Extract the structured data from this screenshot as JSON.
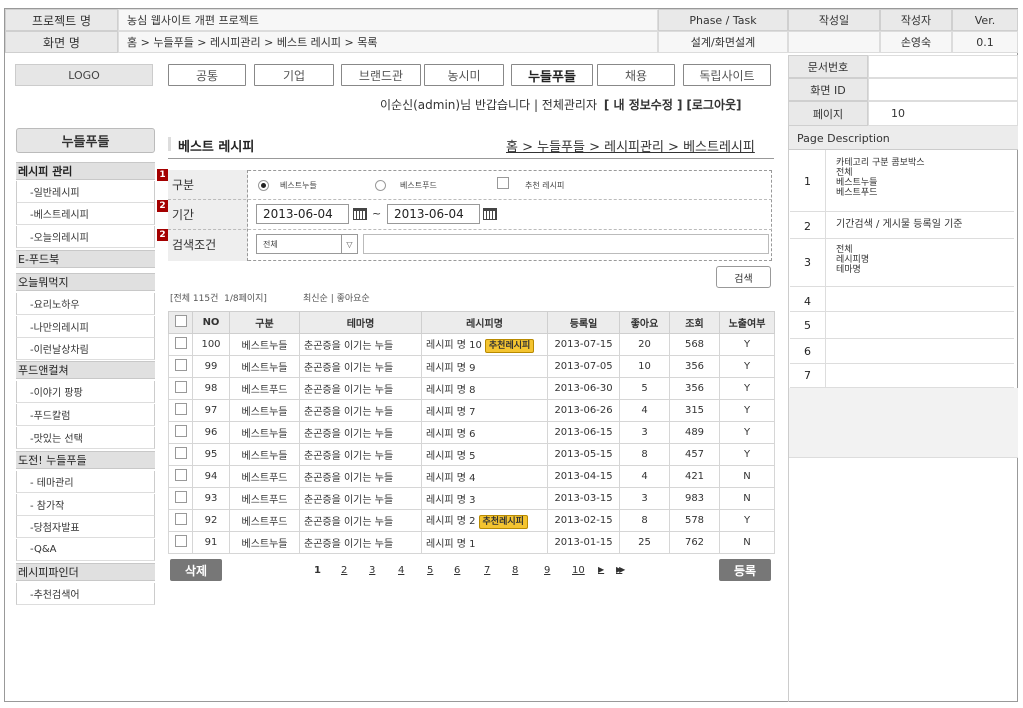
{
  "header": {
    "project_label": "프로젝트 명",
    "project_value": "농심 웹사이트 개편 프로젝트",
    "phase_label": "Phase / Task",
    "date_label": "작성일",
    "author_label": "작성자",
    "ver_label": "Ver.",
    "screen_label": "화면 명",
    "screen_value": "홈 > 누들푸들 > 레시피관리 > 베스트 레시피 > 목록",
    "phase_value": "설계/화면설계",
    "author_value": "손영숙",
    "ver_value": "0.1"
  },
  "meta": {
    "doc_no_label": "문서번호",
    "screen_id_label": "화면 ID",
    "page_label": "페이지",
    "page_value": "10"
  },
  "logo": "LOGO",
  "tabs": [
    "공통",
    "기업",
    "브랜드관",
    "농시미",
    "누들푸들",
    "채용",
    "독립사이트"
  ],
  "user_bar": {
    "greeting": "이순신(admin)님 반갑습니다 | 전체관리자",
    "edit_info": "[ 내 정보수정 ]",
    "logout": "[로그아웃]"
  },
  "sidebar": {
    "title": "누들푸들",
    "groups": [
      {
        "label": "레시피 관리",
        "items": [
          "-일반레시피",
          "-베스트레시피",
          "-오늘의레시피"
        ]
      },
      {
        "label": "E-푸드북",
        "items": []
      },
      {
        "label": "오늘뭐먹지",
        "items": [
          "-요리노하우",
          "-나만의레시피",
          "-이런날상차림"
        ]
      },
      {
        "label": "푸드앤컬쳐",
        "items": [
          "-이야기 팡팡",
          "-푸드칼럼",
          "-맛있는 선택"
        ]
      },
      {
        "label": "도전! 누들푸들",
        "items": [
          "- 테마관리",
          "- 참가작",
          "-당첨자발표",
          "-Q&A"
        ]
      },
      {
        "label": "레시피파인더",
        "items": [
          "-추천검색어"
        ]
      }
    ]
  },
  "content": {
    "section_title": "베스트 레시피",
    "breadcrumb": "홈 > 누들푸들 > 레시피관리 > 베스트레시피"
  },
  "filters": {
    "markers": [
      "1",
      "2",
      "2"
    ],
    "category_label": "구분",
    "radio_best_noodle": "베스트누들",
    "radio_best_food": "베스트푸드",
    "check_recommended": "추천 레시피",
    "period_label": "기간",
    "date_from": "2013-06-04",
    "date_sep": "~",
    "date_to": "2013-06-04",
    "search_cond_label": "검색조건",
    "search_select": "전체",
    "search_button": "검색"
  },
  "list_info": {
    "summary": "[전체 115건  1/8페이지]",
    "sort": "최신순 | 좋아요순"
  },
  "table": {
    "columns": [
      "NO",
      "구분",
      "테마명",
      "레시피명",
      "등록일",
      "좋아요",
      "조회",
      "노출여부"
    ],
    "badge_label": "추천레시피",
    "rows": [
      {
        "no": "100",
        "type": "베스트누들",
        "theme": "춘곤증을 이기는 누들",
        "recipe": "레시피 명 10",
        "badge": true,
        "date": "2013-07-15",
        "likes": "20",
        "views": "568",
        "show": "Y"
      },
      {
        "no": "99",
        "type": "베스트누들",
        "theme": "춘곤증을 이기는 누들",
        "recipe": "레시피 명 9",
        "badge": false,
        "date": "2013-07-05",
        "likes": "10",
        "views": "356",
        "show": "Y"
      },
      {
        "no": "98",
        "type": "베스트푸드",
        "theme": "춘곤증을 이기는 누들",
        "recipe": "레시피 명 8",
        "badge": false,
        "date": "2013-06-30",
        "likes": "5",
        "views": "356",
        "show": "Y"
      },
      {
        "no": "97",
        "type": "베스트누들",
        "theme": "춘곤증을 이기는 누들",
        "recipe": "레시피 명 7",
        "badge": false,
        "date": "2013-06-26",
        "likes": "4",
        "views": "315",
        "show": "Y"
      },
      {
        "no": "96",
        "type": "베스트누들",
        "theme": "춘곤증을 이기는 누들",
        "recipe": "레시피 명 6",
        "badge": false,
        "date": "2013-06-15",
        "likes": "3",
        "views": "489",
        "show": "Y"
      },
      {
        "no": "95",
        "type": "베스트누들",
        "theme": "춘곤증을 이기는 누들",
        "recipe": "레시피 명 5",
        "badge": false,
        "date": "2013-05-15",
        "likes": "8",
        "views": "457",
        "show": "Y"
      },
      {
        "no": "94",
        "type": "베스트푸드",
        "theme": "춘곤증을 이기는 누들",
        "recipe": "레시피 명 4",
        "badge": false,
        "date": "2013-04-15",
        "likes": "4",
        "views": "421",
        "show": "N"
      },
      {
        "no": "93",
        "type": "베스트푸드",
        "theme": "춘곤증을 이기는 누들",
        "recipe": "레시피 명 3",
        "badge": false,
        "date": "2013-03-15",
        "likes": "3",
        "views": "983",
        "show": "N"
      },
      {
        "no": "92",
        "type": "베스트푸드",
        "theme": "춘곤증을 이기는 누들",
        "recipe": "레시피 명 2",
        "badge": true,
        "date": "2013-02-15",
        "likes": "8",
        "views": "578",
        "show": "Y"
      },
      {
        "no": "91",
        "type": "베스트누들",
        "theme": "춘곤증을 이기는 누들",
        "recipe": "레시피 명 1",
        "badge": false,
        "date": "2013-01-15",
        "likes": "25",
        "views": "762",
        "show": "N"
      }
    ]
  },
  "actions": {
    "delete": "삭제",
    "register": "등록"
  },
  "pagination": {
    "pages": [
      "1",
      "2",
      "3",
      "4",
      "5",
      "6",
      "7",
      "8",
      "9",
      "10"
    ],
    "next": "▶",
    "last": "▶▶"
  },
  "description": {
    "title": "Page Description",
    "items": [
      {
        "num": "1",
        "text": "카테고리 구분 콤보박스\n전체\n베스트누들\n베스트푸드"
      },
      {
        "num": "2",
        "text": "기간검색 / 게시물 등록일 기준"
      },
      {
        "num": "3",
        "text": "전체\n레시피명\n테마명"
      },
      {
        "num": "4",
        "text": ""
      },
      {
        "num": "5",
        "text": ""
      },
      {
        "num": "6",
        "text": ""
      },
      {
        "num": "7",
        "text": ""
      }
    ]
  },
  "colors": {
    "marker": "#a40000",
    "badge": "#f4c430",
    "button": "#777777"
  }
}
